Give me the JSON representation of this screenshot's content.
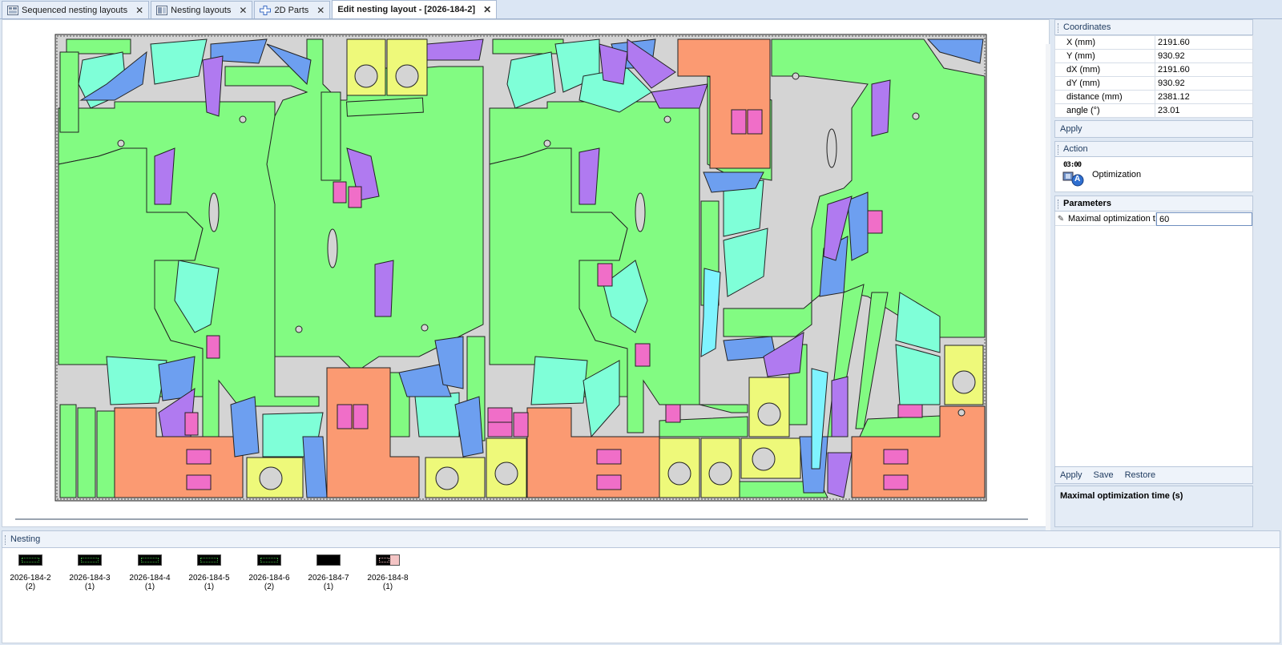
{
  "tabs": [
    {
      "label": "Sequenced nesting layouts",
      "active": false
    },
    {
      "label": "Nesting layouts",
      "active": false
    },
    {
      "label": "2D Parts",
      "active": false
    },
    {
      "label": "Edit nesting layout  - [2026-184-2]",
      "active": true
    }
  ],
  "close_glyph": "✕",
  "coordinates": {
    "title": "Coordinates",
    "rows": [
      {
        "label": "X (mm)",
        "value": "2191.60"
      },
      {
        "label": "Y (mm)",
        "value": "930.92"
      },
      {
        "label": "dX (mm)",
        "value": "2191.60"
      },
      {
        "label": "dY (mm)",
        "value": "930.92"
      },
      {
        "label": "distance (mm)",
        "value": "2381.12"
      },
      {
        "label": "angle (°)",
        "value": "23.01"
      }
    ],
    "apply_label": "Apply"
  },
  "action": {
    "title": "Action",
    "icon_time": "03:00",
    "icon_badge": "A",
    "label": "Optimization"
  },
  "parameters": {
    "title": "Parameters",
    "name": "Maximal optimization t",
    "value": "60",
    "buttons": {
      "apply": "Apply",
      "save": "Save",
      "restore": "Restore"
    },
    "help_title": "Maximal optimization time (s)"
  },
  "nesting": {
    "title": "Nesting",
    "items": [
      {
        "name": "2026-184-2",
        "count": "(2)"
      },
      {
        "name": "2026-184-3",
        "count": "(1)"
      },
      {
        "name": "2026-184-4",
        "count": "(1)"
      },
      {
        "name": "2026-184-5",
        "count": "(1)"
      },
      {
        "name": "2026-184-6",
        "count": "(2)"
      },
      {
        "name": "2026-184-7",
        "count": "(1)"
      },
      {
        "name": "2026-184-8",
        "count": "(1)"
      }
    ]
  },
  "colors": {
    "green": "#82fb82",
    "salmon": "#fb9a72",
    "yellow": "#eef97a",
    "teal": "#7fffd8",
    "blue": "#6d9ff0",
    "purple": "#b07af0",
    "pink": "#f06ec8",
    "cyan": "#7ff4ff",
    "sheet": "#d4d4d4"
  }
}
